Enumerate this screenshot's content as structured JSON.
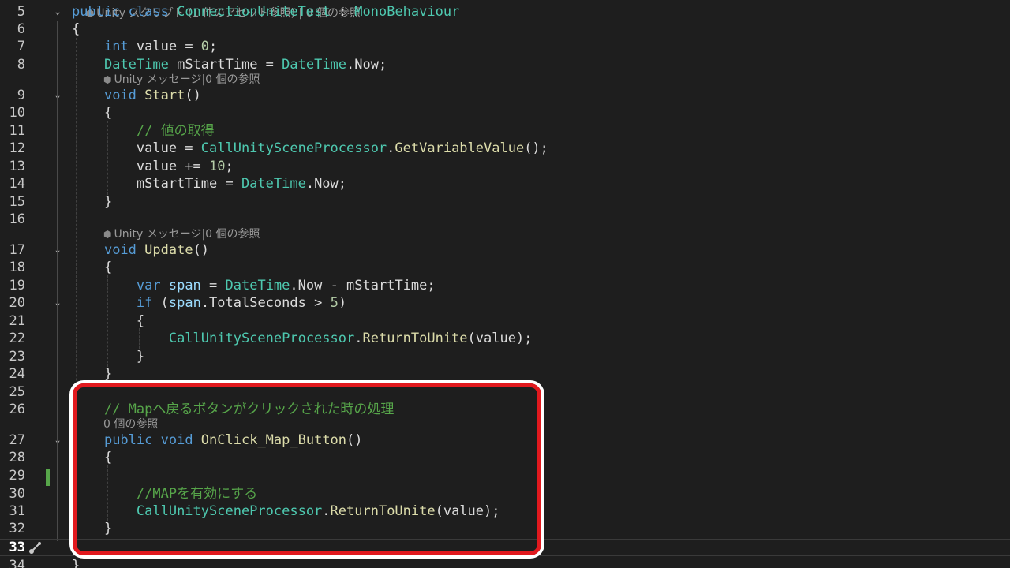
{
  "lens_top": "Unity スクリプト (1 件のアセット参照) | 0 個の参照",
  "lines": [
    {
      "n": "5",
      "fold": true,
      "tokens": [
        [
          "kw",
          "public "
        ],
        [
          "kw",
          "class "
        ],
        [
          "ty",
          "ConnectionUniteTest"
        ],
        [
          "pl",
          " : "
        ],
        [
          "ty",
          "MonoBehaviour"
        ]
      ]
    },
    {
      "n": "6",
      "tokens": [
        [
          "pl",
          "{"
        ]
      ]
    },
    {
      "n": "7",
      "tokens": [
        [
          "pl",
          "    "
        ],
        [
          "kw",
          "int "
        ],
        [
          "pl",
          "value = "
        ],
        [
          "nm",
          "0"
        ],
        [
          "pl",
          ";"
        ]
      ]
    },
    {
      "n": "8",
      "tokens": [
        [
          "pl",
          "    "
        ],
        [
          "ty",
          "DateTime"
        ],
        [
          "pl",
          " mStartTime = "
        ],
        [
          "ty",
          "DateTime"
        ],
        [
          "pl",
          ".Now;"
        ]
      ]
    },
    {
      "n": "9",
      "fold": true,
      "tokens": [
        [
          "pl",
          "    "
        ],
        [
          "kw",
          "void "
        ],
        [
          "fn",
          "Start"
        ],
        [
          "pl",
          "()"
        ]
      ]
    },
    {
      "n": "10",
      "tokens": [
        [
          "pl",
          "    {"
        ]
      ]
    },
    {
      "n": "11",
      "tokens": [
        [
          "pl",
          "        "
        ],
        [
          "cm",
          "// 値の取得"
        ]
      ]
    },
    {
      "n": "12",
      "tokens": [
        [
          "pl",
          "        value = "
        ],
        [
          "ty",
          "CallUnitySceneProcessor"
        ],
        [
          "pl",
          "."
        ],
        [
          "fn",
          "GetVariableValue"
        ],
        [
          "pl",
          "();"
        ]
      ]
    },
    {
      "n": "13",
      "tokens": [
        [
          "pl",
          "        value += "
        ],
        [
          "nm",
          "10"
        ],
        [
          "pl",
          ";"
        ]
      ]
    },
    {
      "n": "14",
      "tokens": [
        [
          "pl",
          "        mStartTime = "
        ],
        [
          "ty",
          "DateTime"
        ],
        [
          "pl",
          ".Now;"
        ]
      ]
    },
    {
      "n": "15",
      "tokens": [
        [
          "pl",
          "    }"
        ]
      ]
    },
    {
      "n": "16",
      "tokens": []
    },
    {
      "n": "17",
      "fold": true,
      "tokens": [
        [
          "pl",
          "    "
        ],
        [
          "kw",
          "void "
        ],
        [
          "fn",
          "Update"
        ],
        [
          "pl",
          "()"
        ]
      ]
    },
    {
      "n": "18",
      "tokens": [
        [
          "pl",
          "    {"
        ]
      ]
    },
    {
      "n": "19",
      "tokens": [
        [
          "pl",
          "        "
        ],
        [
          "kw",
          "var "
        ],
        [
          "vr",
          "span"
        ],
        [
          "pl",
          " = "
        ],
        [
          "ty",
          "DateTime"
        ],
        [
          "pl",
          ".Now - mStartTime;"
        ]
      ]
    },
    {
      "n": "20",
      "fold": true,
      "tokens": [
        [
          "pl",
          "        "
        ],
        [
          "kw",
          "if "
        ],
        [
          "pl",
          "("
        ],
        [
          "vr",
          "span"
        ],
        [
          "pl",
          ".TotalSeconds > "
        ],
        [
          "nm",
          "5"
        ],
        [
          "pl",
          ")"
        ]
      ]
    },
    {
      "n": "21",
      "tokens": [
        [
          "pl",
          "        {"
        ]
      ]
    },
    {
      "n": "22",
      "tokens": [
        [
          "pl",
          "            "
        ],
        [
          "ty",
          "CallUnitySceneProcessor"
        ],
        [
          "pl",
          "."
        ],
        [
          "fn",
          "ReturnToUnite"
        ],
        [
          "pl",
          "(value);"
        ]
      ]
    },
    {
      "n": "23",
      "tokens": [
        [
          "pl",
          "        }"
        ]
      ]
    },
    {
      "n": "24",
      "tokens": [
        [
          "pl",
          "    }"
        ]
      ]
    },
    {
      "n": "25",
      "tokens": []
    },
    {
      "n": "26",
      "tokens": [
        [
          "pl",
          "    "
        ],
        [
          "cm",
          "// Mapへ戻るボタンがクリックされた時の処理"
        ]
      ]
    },
    {
      "n": "27",
      "fold": true,
      "tokens": [
        [
          "pl",
          "    "
        ],
        [
          "kw",
          "public "
        ],
        [
          "kw",
          "void "
        ],
        [
          "fn",
          "OnClick_Map_Button"
        ],
        [
          "pl",
          "()"
        ]
      ]
    },
    {
      "n": "28",
      "tokens": [
        [
          "pl",
          "    {"
        ]
      ]
    },
    {
      "n": "29",
      "tokens": []
    },
    {
      "n": "30",
      "tokens": [
        [
          "pl",
          "        "
        ],
        [
          "cm",
          "//MAPを有効にする"
        ]
      ]
    },
    {
      "n": "31",
      "tokens": [
        [
          "pl",
          "        "
        ],
        [
          "ty",
          "CallUnitySceneProcessor"
        ],
        [
          "pl",
          "."
        ],
        [
          "fn",
          "ReturnToUnite"
        ],
        [
          "pl",
          "(value);"
        ]
      ]
    },
    {
      "n": "32",
      "tokens": [
        [
          "pl",
          "    }"
        ]
      ]
    },
    {
      "n": "33",
      "active": true,
      "tokens": []
    },
    {
      "n": "34",
      "tokens": [
        [
          "pl",
          "}"
        ]
      ]
    }
  ],
  "code_lens": [
    {
      "after_line": "8",
      "text": "Unity メッセージ|0 個の参照",
      "unity": true
    },
    {
      "after_line": "16",
      "text": "Unity メッセージ|0 個の参照",
      "unity": true
    },
    {
      "after_line": "26",
      "text": "0 個の参照",
      "unity": false
    }
  ],
  "colors": {
    "background": "#1e1e1e",
    "keyword": "#569cd6",
    "type": "#4ec9b0",
    "method": "#dcdcaa",
    "comment": "#57a64a",
    "number": "#b5cea8",
    "highlight_border": "#e1191e",
    "change_marker": "#57a64a"
  },
  "icons": {
    "fold": "chevron-down-icon",
    "unity_lens": "unity-cube-icon",
    "quick_action": "brush-icon"
  }
}
